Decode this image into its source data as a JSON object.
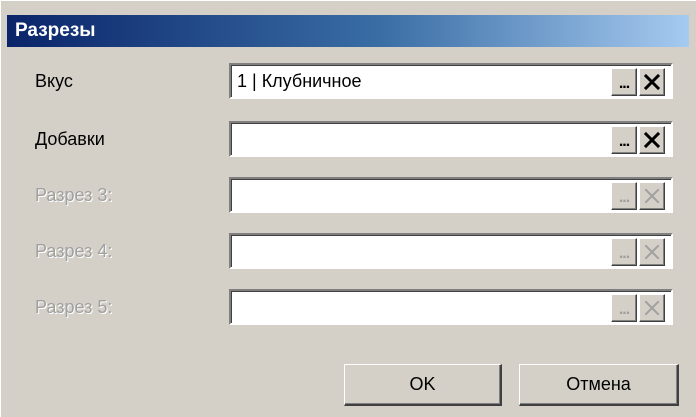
{
  "window": {
    "title": "Разрезы"
  },
  "rows": [
    {
      "label": "Вкус",
      "value": "1 | Клубничное",
      "dots": "...",
      "enabled": true
    },
    {
      "label": "Добавки",
      "value": "",
      "dots": "...",
      "enabled": true
    },
    {
      "label": "Разрез 3:",
      "value": "",
      "dots": "...",
      "enabled": false
    },
    {
      "label": "Разрез 4:",
      "value": "",
      "dots": "...",
      "enabled": false
    },
    {
      "label": "Разрез 5:",
      "value": "",
      "dots": "...",
      "enabled": false
    }
  ],
  "icons": {
    "browse": "ellipsis-icon",
    "clear": "close-icon"
  },
  "buttons": {
    "ok_label": "OK",
    "cancel_label": "Отмена"
  },
  "colors": {
    "title_start": "#0a246a",
    "title_end": "#a6caf0",
    "face": "#d4d0c8",
    "disabled_text": "#a0a0a0"
  }
}
